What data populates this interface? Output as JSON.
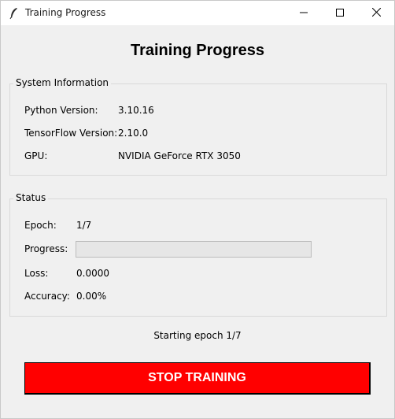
{
  "window": {
    "title": "Training Progress",
    "icon": "feather-icon",
    "controls": [
      "minimize-icon",
      "maximize-icon",
      "close-icon"
    ]
  },
  "heading": "Training Progress",
  "system_info": {
    "legend": "System Information",
    "rows": [
      {
        "label": "Python Version:",
        "value": "3.10.16"
      },
      {
        "label": "TensorFlow Version:",
        "value": "2.10.0"
      },
      {
        "label": "GPU:",
        "value": "NVIDIA GeForce RTX 3050"
      }
    ]
  },
  "status": {
    "legend": "Status",
    "epoch_label": "Epoch:",
    "epoch_value": "1/7",
    "progress_label": "Progress:",
    "progress_fraction": 0.0,
    "loss_label": "Loss:",
    "loss_value": "0.0000",
    "accuracy_label": "Accuracy:",
    "accuracy_value": "0.00%"
  },
  "status_message": "Starting epoch 1/7",
  "stop_button": {
    "label": "STOP TRAINING",
    "background": "#ff0000",
    "text_color": "#ffffff"
  }
}
